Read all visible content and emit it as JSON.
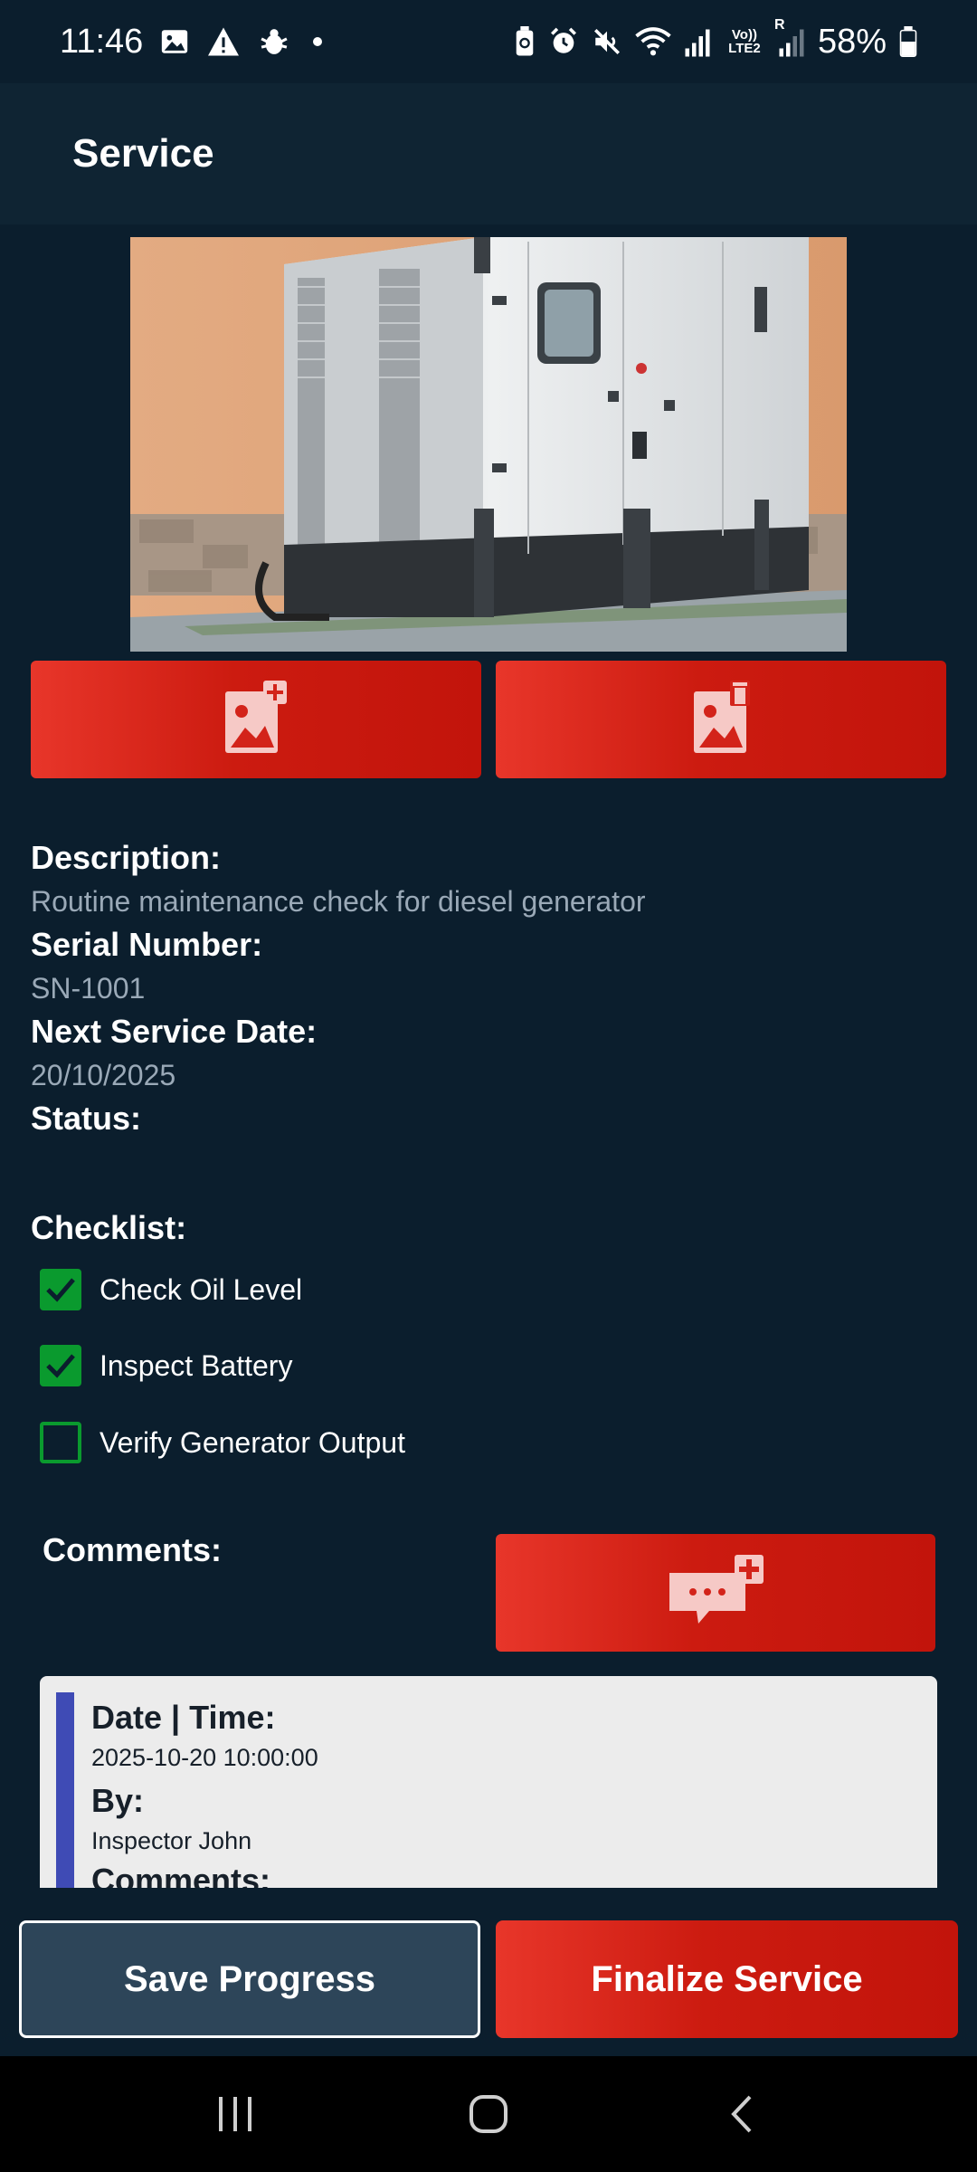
{
  "status_bar": {
    "time": "11:46",
    "battery": "58%",
    "left_icons": [
      "gallery-icon",
      "warning-icon",
      "bug-icon",
      "dot-icon"
    ],
    "right_icons": [
      "battery-saver-icon",
      "alarm-icon",
      "mute-icon",
      "wifi-icon",
      "signal-icon",
      "volte-icon",
      "signal-roaming-icon",
      "battery-icon"
    ],
    "volte_label": "Vo)) LTE2",
    "roaming_label": "R"
  },
  "app_bar": {
    "title": "Service"
  },
  "photo_buttons": {
    "add_icon": "add-photo-icon",
    "delete_icon": "delete-photo-icon"
  },
  "details": {
    "description_label": "Description:",
    "description_value": "Routine maintenance check for diesel generator",
    "serial_label": "Serial Number:",
    "serial_value": "SN-1001",
    "next_service_label": "Next Service Date:",
    "next_service_value": "20/10/2025",
    "status_label": "Status:"
  },
  "checklist": {
    "title": "Checklist:",
    "items": [
      {
        "label": "Check Oil Level",
        "checked": true
      },
      {
        "label": "Inspect Battery",
        "checked": true
      },
      {
        "label": "Verify Generator Output",
        "checked": false
      }
    ]
  },
  "comments": {
    "title": "Comments:",
    "add_icon": "add-comment-icon",
    "entries": [
      {
        "date_label": "Date | Time:",
        "date_value": "2025-10-20 10:00:00",
        "by_label": "By:",
        "by_value": "Inspector John",
        "comments_label": "Comments:"
      }
    ]
  },
  "actions": {
    "save_label": "Save Progress",
    "finalize_label": "Finalize Service"
  },
  "nav_bar": {
    "icons": [
      "recents-icon",
      "home-icon",
      "back-icon"
    ]
  },
  "colors": {
    "background": "#0b1e2d",
    "app_bar": "#0f2433",
    "accent_red": "#d3231a",
    "check_green": "#0a9a2e",
    "comment_accent": "#3f4bb5"
  }
}
